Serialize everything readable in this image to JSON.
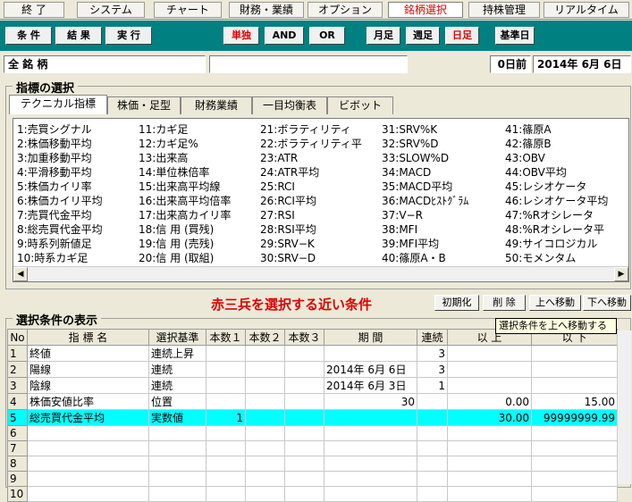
{
  "menu": [
    "終 了",
    "システム",
    "チャート",
    "財務・業績",
    "オプション",
    "銘柄選択",
    "持株管理",
    "リアルタイム"
  ],
  "toolbar": {
    "buttons": [
      "条 件",
      "結 果",
      "実 行",
      "単独",
      "AND",
      "OR",
      "月足",
      "週足",
      "日足",
      "基準日"
    ]
  },
  "info": {
    "stock_label": "全 銘 柄",
    "middle": "",
    "days_before": "0日前",
    "date": "2014年 6月 6日"
  },
  "indicator_group": {
    "title": "指標の選択",
    "tabs": [
      "テクニカル指標",
      "株価・足型",
      "財務業績",
      "一目均衡表",
      "ビボット"
    ],
    "columns": [
      [
        "1:売買シグナル",
        "2:株価移動平均",
        "3:加重移動平均",
        "4:平滑移動平均",
        "5:株価カイリ率",
        "6:株価カイリ平均",
        "7:売買代金平均",
        "8:総売買代金平均",
        "9:時系列新値足",
        "10:時系カギ足"
      ],
      [
        "11:カギ足",
        "12:カギ足%",
        "13:出来高",
        "14:単位株倍率",
        "15:出来高平均線",
        "16:出来高平均倍率",
        "17:出来高カイリ率",
        "18:信 用 (買残)",
        "19:信 用 (売残)",
        "20:信 用 (取組)"
      ],
      [
        "21:ボラティリティ",
        "22:ボラティリティ平",
        "23:ATR",
        "24:ATR平均",
        "25:RCI",
        "26:RCI平均",
        "27:RSI",
        "28:RSI平均",
        "29:SRV−K",
        "30:SRV−D"
      ],
      [
        "31:SRV%K",
        "32:SRV%D",
        "33:SLOW%D",
        "34:MACD",
        "35:MACD平均",
        "36:MACDﾋｽﾄｸﾞﾗﾑ",
        "37:V−R",
        "38:MFI",
        "39:MFI平均",
        "40:篠原A・B"
      ],
      [
        "41:篠原A",
        "42:篠原B",
        "43:OBV",
        "44:OBV平均",
        "45:レシオケータ",
        "46:レシオケータ平均",
        "47:%Rオシレータ",
        "48:%Rオシレータ平",
        "49:サイコロジカル",
        "50:モメンタム"
      ]
    ]
  },
  "condition_group": {
    "title": "選択条件の表示",
    "heading": "赤三兵を選択する近い条件",
    "buttons": [
      "初期化",
      "削 除",
      "上へ移動",
      "下へ移動"
    ],
    "tooltip": "選択条件を上へ移動する",
    "table": {
      "headers": [
        "No",
        "指 標 名",
        "選択基準",
        "本数１",
        "本数２",
        "本数３",
        "期 間",
        "連続",
        "以 上",
        "以 下"
      ],
      "rows": [
        [
          "1",
          "終値",
          "連続上昇",
          "",
          "",
          "",
          "",
          "3",
          "",
          ""
        ],
        [
          "2",
          "陽線",
          "連続",
          "",
          "",
          "",
          "2014年 6月 6日",
          "3",
          "",
          ""
        ],
        [
          "3",
          "陰線",
          "連続",
          "",
          "",
          "",
          "2014年 6月 3日",
          "1",
          "",
          ""
        ],
        [
          "4",
          "株価安値比率",
          "位置",
          "",
          "",
          "",
          "30",
          "",
          "0.00",
          "15.00"
        ],
        [
          "5",
          "総売買代金平均",
          "実数値",
          "1",
          "",
          "",
          "",
          "",
          "30.00",
          "99999999.99"
        ],
        [
          "6",
          "",
          "",
          "",
          "",
          "",
          "",
          "",
          "",
          ""
        ],
        [
          "7",
          "",
          "",
          "",
          "",
          "",
          "",
          "",
          "",
          ""
        ],
        [
          "8",
          "",
          "",
          "",
          "",
          "",
          "",
          "",
          "",
          ""
        ],
        [
          "9",
          "",
          "",
          "",
          "",
          "",
          "",
          "",
          "",
          ""
        ],
        [
          "10",
          "",
          "",
          "",
          "",
          "",
          "",
          "",
          "",
          ""
        ]
      ],
      "selected_row": 5
    }
  },
  "colors": {
    "toolbar": "#008080",
    "selected_row": "#00ffff",
    "accent_red": "#e00000"
  }
}
